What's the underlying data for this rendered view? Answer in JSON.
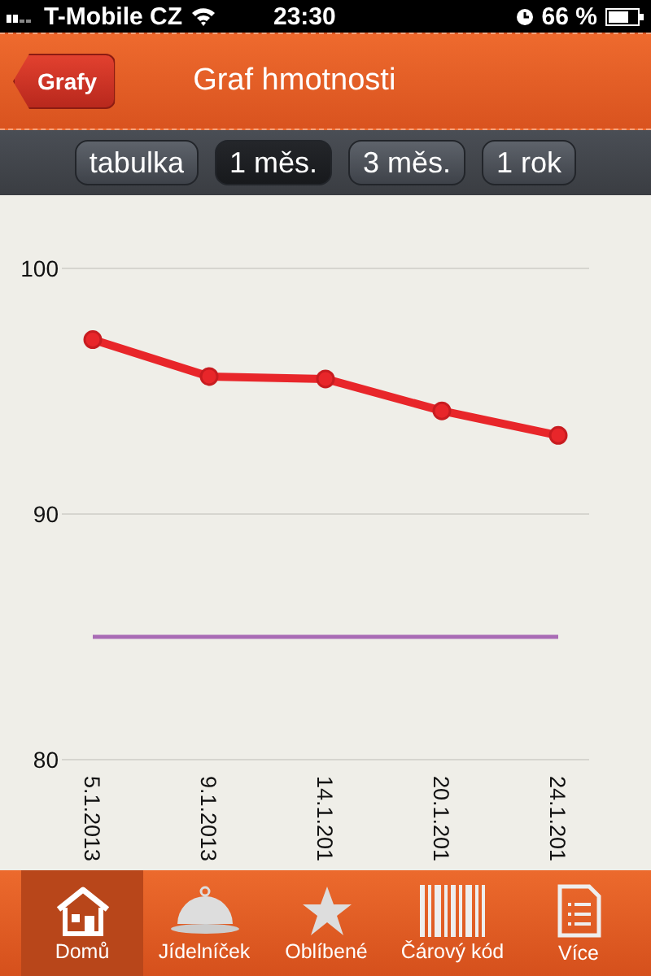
{
  "status_bar": {
    "carrier": "T-Mobile CZ",
    "time": "23:30",
    "battery": "66 %"
  },
  "nav_bar": {
    "back": "Grafy",
    "title": "Graf hmotnosti"
  },
  "segments": [
    {
      "label": "tabulka",
      "selected": false
    },
    {
      "label": "1 měs.",
      "selected": true
    },
    {
      "label": "3 měs.",
      "selected": false
    },
    {
      "label": "1 rok",
      "selected": false
    }
  ],
  "chart_data": {
    "type": "line",
    "categories": [
      "5.1.2013",
      "9.1.2013",
      "14.1.201",
      "20.1.201",
      "24.1.201"
    ],
    "ylim": [
      80,
      100
    ],
    "yticks": [
      80,
      90,
      100
    ],
    "series": [
      {
        "color": "#e8262a",
        "marker": true,
        "values": [
          97.1,
          95.6,
          95.5,
          94.2,
          93.2
        ]
      },
      {
        "color": "#a96bb5",
        "marker": false,
        "values": [
          85,
          85,
          85,
          85,
          85
        ]
      }
    ]
  },
  "tab_bar": [
    {
      "label": "Domů",
      "kind": "house",
      "selected": true
    },
    {
      "label": "Jídelníček",
      "kind": "cloche",
      "selected": false
    },
    {
      "label": "Oblíbené",
      "kind": "star",
      "selected": false
    },
    {
      "label": "Čárový kód",
      "kind": "barcode",
      "selected": false
    },
    {
      "label": "Více",
      "kind": "list",
      "selected": false
    }
  ]
}
